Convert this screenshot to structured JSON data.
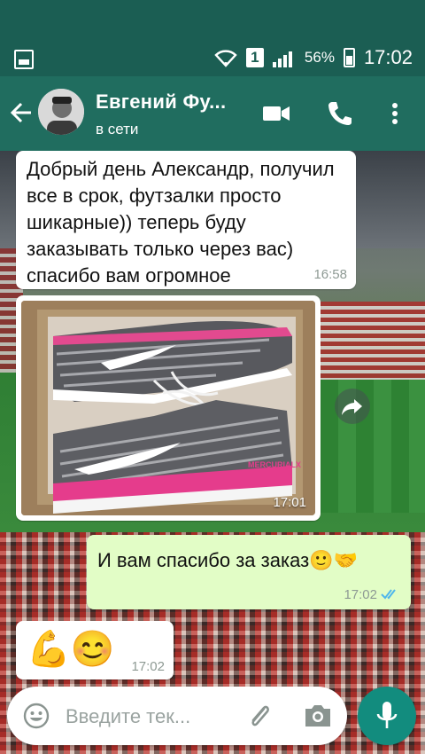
{
  "status_bar": {
    "sim_label": "1",
    "battery": "56%",
    "time": "17:02"
  },
  "header": {
    "contact_name": "Евгений Фу...",
    "contact_status": "в сети"
  },
  "messages": [
    {
      "direction": "incoming",
      "text": "Добрый день Александр, получил все в срок, футзалки просто шикарные)) теперь буду заказывать только через вас) спасибо вам огромное",
      "time": "16:58"
    },
    {
      "direction": "incoming",
      "type": "photo",
      "photo_brand_text": "MERCURIALX",
      "time": "17:01"
    },
    {
      "direction": "outgoing",
      "text": "И вам спасибо за заказ🙂🤝",
      "time": "17:02",
      "status": "read"
    },
    {
      "direction": "incoming",
      "text": "💪😊",
      "time": "17:02"
    }
  ],
  "composer": {
    "placeholder": "Введите тек..."
  },
  "colors": {
    "status_bar": "#1b5e53",
    "app_bar": "#206d5f",
    "outgoing_bubble": "#e2fdc6",
    "incoming_bubble": "#ffffff",
    "mic_button": "#128c7e",
    "read_ticks": "#4fb6ec"
  },
  "icons": [
    "gallery-notification-icon",
    "wifi-icon",
    "signal-icon",
    "battery-icon",
    "back-arrow-icon",
    "video-call-icon",
    "phone-icon",
    "more-vert-icon",
    "share-forward-icon",
    "double-check-icon",
    "emoji-icon",
    "attach-icon",
    "camera-icon",
    "mic-icon"
  ]
}
